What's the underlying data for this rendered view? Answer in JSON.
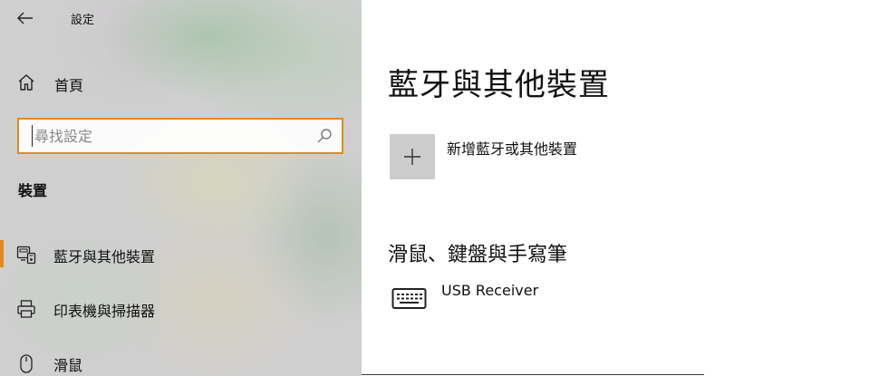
{
  "window": {
    "title": "設定",
    "back_icon": "back-arrow-icon"
  },
  "sidebar": {
    "home": {
      "label": "首頁",
      "icon": "home-icon"
    },
    "search": {
      "placeholder": "尋找設定",
      "value": "",
      "icon": "search-icon"
    },
    "section_heading": "裝置",
    "items": [
      {
        "label": "藍牙與其他裝置",
        "icon": "bluetooth-devices-icon",
        "active": true
      },
      {
        "label": "印表機與掃描器",
        "icon": "printer-icon",
        "active": false
      },
      {
        "label": "滑鼠",
        "icon": "mouse-icon",
        "active": false
      }
    ]
  },
  "main": {
    "title": "藍牙與其他裝置",
    "add_device": {
      "label": "新增藍牙或其他裝置",
      "icon": "plus-icon"
    },
    "sections": [
      {
        "heading": "滑鼠、鍵盤與手寫筆",
        "devices": [
          {
            "name": "USB Receiver",
            "icon": "keyboard-icon"
          }
        ]
      }
    ]
  },
  "colors": {
    "accent": "#e08a1f",
    "tile": "#cccccc",
    "text": "#111111"
  }
}
